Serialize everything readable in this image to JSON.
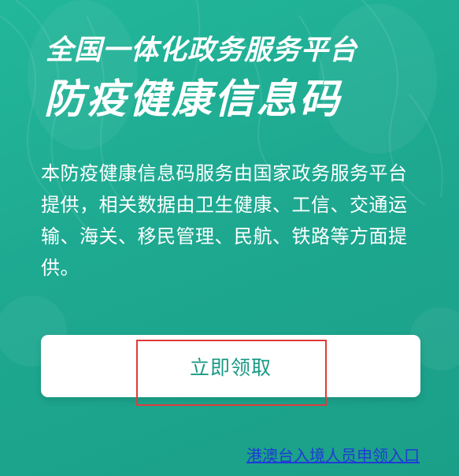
{
  "header": {
    "platform_title": "全国一体化政务服务平台",
    "code_title": "防疫健康信息码"
  },
  "intro": {
    "description": "本防疫健康信息码服务由国家政务服务平台提供，相关数据由卫生健康、工信、交通运输、海关、移民管理、民航、铁路等方面提供。"
  },
  "actions": {
    "claim_label": "立即领取",
    "hk_macau_taiwan_link": "港澳台入境人员申领入口"
  },
  "colors": {
    "background": "#1fab93",
    "button_text": "#1a9a86",
    "highlight": "#e03a3a",
    "link": "#1f3bd6"
  }
}
